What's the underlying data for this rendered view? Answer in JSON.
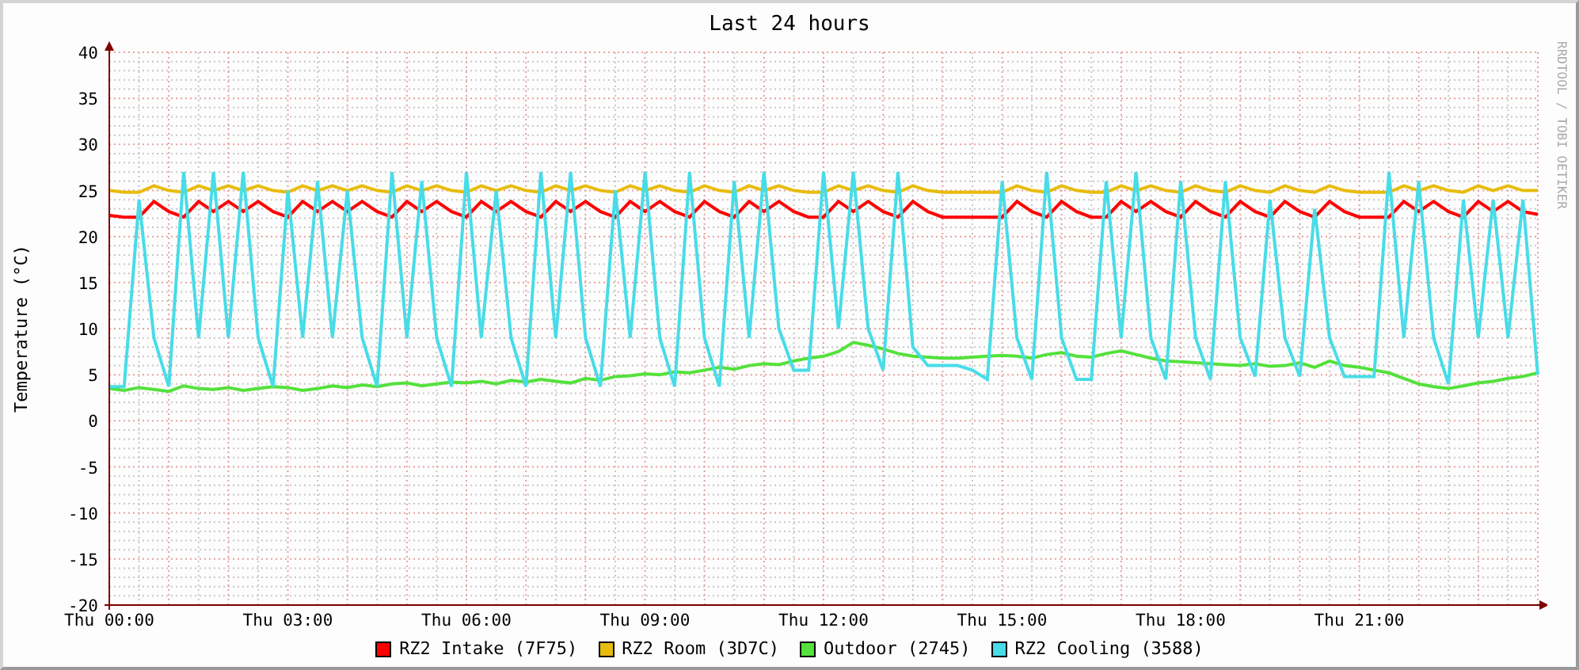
{
  "credit": "RRDTOOL / TOBI OETIKER",
  "chart_data": {
    "type": "line",
    "grid": true,
    "title": "Last 24 hours",
    "ylabel": "Temperature (°C)",
    "ylim": [
      -20,
      40
    ],
    "yticks": [
      -20,
      -15,
      -10,
      -5,
      0,
      5,
      10,
      15,
      20,
      25,
      30,
      35,
      40
    ],
    "categories": [
      "Thu 00:00",
      null,
      null,
      null,
      null,
      null,
      null,
      null,
      null,
      null,
      null,
      null,
      "Thu 03:00",
      null,
      null,
      null,
      null,
      null,
      null,
      null,
      null,
      null,
      null,
      null,
      "Thu 06:00",
      null,
      null,
      null,
      null,
      null,
      null,
      null,
      null,
      null,
      null,
      null,
      "Thu 09:00",
      null,
      null,
      null,
      null,
      null,
      null,
      null,
      null,
      null,
      null,
      null,
      "Thu 12:00",
      null,
      null,
      null,
      null,
      null,
      null,
      null,
      null,
      null,
      null,
      null,
      "Thu 15:00",
      null,
      null,
      null,
      null,
      null,
      null,
      null,
      null,
      null,
      null,
      null,
      "Thu 18:00",
      null,
      null,
      null,
      null,
      null,
      null,
      null,
      null,
      null,
      null,
      null,
      "Thu 21:00",
      null,
      null,
      null,
      null,
      null,
      null,
      null,
      null,
      null,
      null,
      null,
      null
    ],
    "series": [
      {
        "name": "RZ2 Intake (7F75)",
        "color": "#ff0000",
        "values": [
          22.3,
          22.1,
          22.1,
          23.8,
          22.7,
          22.1,
          23.8,
          22.7,
          23.8,
          22.7,
          23.8,
          22.7,
          22.1,
          23.8,
          22.7,
          23.8,
          22.7,
          23.8,
          22.7,
          22.1,
          23.8,
          22.7,
          23.8,
          22.7,
          22.1,
          23.8,
          22.7,
          23.8,
          22.7,
          22.1,
          23.8,
          22.7,
          23.8,
          22.7,
          22.1,
          23.8,
          22.7,
          23.8,
          22.7,
          22.1,
          23.8,
          22.7,
          22.1,
          23.8,
          22.7,
          23.8,
          22.7,
          22.1,
          22.1,
          23.8,
          22.7,
          23.8,
          22.7,
          22.1,
          23.8,
          22.7,
          22.1,
          22.1,
          22.1,
          22.1,
          22.1,
          23.8,
          22.7,
          22.1,
          23.8,
          22.7,
          22.1,
          22.1,
          23.8,
          22.7,
          23.8,
          22.7,
          22.1,
          23.8,
          22.7,
          22.1,
          23.8,
          22.7,
          22.1,
          23.8,
          22.7,
          22.1,
          23.8,
          22.7,
          22.1,
          22.1,
          22.1,
          23.8,
          22.7,
          23.8,
          22.7,
          22.1,
          23.8,
          22.7,
          23.8,
          22.7,
          22.4
        ]
      },
      {
        "name": "RZ2 Room (3D7C)",
        "color": "#e8bc0c",
        "values": [
          25.0,
          24.8,
          24.8,
          25.5,
          25.0,
          24.8,
          25.5,
          25.0,
          25.5,
          25.0,
          25.5,
          25.0,
          24.8,
          25.5,
          25.0,
          25.5,
          25.0,
          25.5,
          25.0,
          24.8,
          25.5,
          25.0,
          25.5,
          25.0,
          24.8,
          25.5,
          25.0,
          25.5,
          25.0,
          24.8,
          25.5,
          25.0,
          25.5,
          25.0,
          24.8,
          25.5,
          25.0,
          25.5,
          25.0,
          24.8,
          25.5,
          25.0,
          24.8,
          25.5,
          25.0,
          25.5,
          25.0,
          24.8,
          24.8,
          25.5,
          25.0,
          25.5,
          25.0,
          24.8,
          25.5,
          25.0,
          24.8,
          24.8,
          24.8,
          24.8,
          24.8,
          25.5,
          25.0,
          24.8,
          25.5,
          25.0,
          24.8,
          24.8,
          25.5,
          25.0,
          25.5,
          25.0,
          24.8,
          25.5,
          25.0,
          24.8,
          25.5,
          25.0,
          24.8,
          25.5,
          25.0,
          24.8,
          25.5,
          25.0,
          24.8,
          24.8,
          24.8,
          25.5,
          25.0,
          25.5,
          25.0,
          24.8,
          25.5,
          25.0,
          25.5,
          25.0,
          25.0
        ]
      },
      {
        "name": "Outdoor (2745)",
        "color": "#54e13c",
        "values": [
          3.5,
          3.3,
          3.6,
          3.4,
          3.2,
          3.8,
          3.5,
          3.4,
          3.6,
          3.3,
          3.5,
          3.7,
          3.6,
          3.3,
          3.5,
          3.8,
          3.6,
          3.9,
          3.7,
          4.0,
          4.1,
          3.8,
          4.0,
          4.2,
          4.1,
          4.3,
          4.0,
          4.4,
          4.2,
          4.5,
          4.3,
          4.1,
          4.6,
          4.4,
          4.8,
          4.9,
          5.1,
          5.0,
          5.3,
          5.2,
          5.5,
          5.8,
          5.6,
          6.0,
          6.2,
          6.1,
          6.5,
          6.8,
          7.0,
          7.5,
          8.5,
          8.2,
          7.8,
          7.3,
          7.0,
          6.9,
          6.8,
          6.8,
          6.9,
          7.0,
          7.1,
          7.0,
          6.8,
          7.2,
          7.4,
          7.0,
          6.9,
          7.3,
          7.6,
          7.2,
          6.8,
          6.5,
          6.4,
          6.3,
          6.2,
          6.1,
          6.0,
          6.2,
          5.9,
          6.0,
          6.3,
          5.8,
          6.5,
          6.0,
          5.8,
          5.5,
          5.2,
          4.6,
          4.0,
          3.7,
          3.5,
          3.8,
          4.1,
          4.3,
          4.6,
          4.8,
          5.2
        ]
      },
      {
        "name": "RZ2 Cooling (3588)",
        "color": "#48dce8",
        "values": [
          3.7,
          3.7,
          24,
          9,
          3.7,
          27,
          9,
          27,
          9,
          27,
          9,
          3.7,
          25,
          9,
          26,
          9,
          25,
          9,
          3.7,
          27,
          9,
          26,
          9,
          3.7,
          27,
          9,
          25,
          9,
          3.7,
          27,
          9,
          27,
          9,
          3.7,
          25,
          9,
          27,
          9,
          3.7,
          27,
          9,
          3.7,
          26,
          9,
          27,
          10,
          5.5,
          5.5,
          27,
          10,
          27,
          10,
          5.5,
          27,
          8,
          6,
          6,
          6,
          5.5,
          4.5,
          26,
          9,
          4.5,
          27,
          9,
          4.5,
          4.5,
          26,
          9,
          27,
          9,
          4.5,
          26,
          9,
          4.5,
          26,
          9,
          4.8,
          24,
          9,
          4.8,
          23,
          9,
          4.8,
          4.8,
          4.8,
          27,
          9,
          26,
          9,
          4,
          24,
          9,
          24,
          9,
          24,
          5
        ]
      }
    ]
  }
}
